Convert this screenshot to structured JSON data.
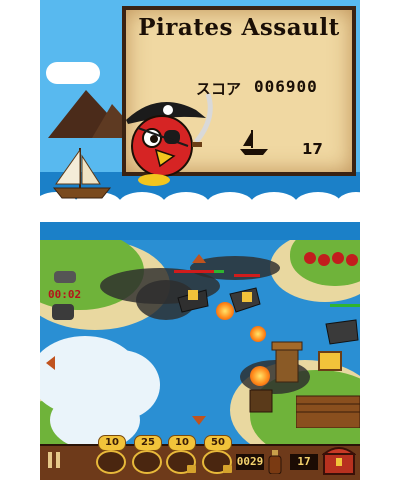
{
  "top_screen": {
    "title": "Pirates Assault",
    "score_label": "スコア",
    "score_value": "006900",
    "ships_remaining": "17"
  },
  "bottom_screen": {
    "timer": "00:02",
    "weapons": [
      {
        "cost": "10",
        "icon": "cannon-icon"
      },
      {
        "cost": "25",
        "icon": "skull-icon"
      },
      {
        "cost": "10",
        "icon": "barrel-icon",
        "locked": true
      },
      {
        "cost": "50",
        "icon": "bomb-icon",
        "locked": true
      }
    ],
    "gold": "0029",
    "lives": "17"
  },
  "colors": {
    "sky": "#58b9ef",
    "sea": "#2a8fd3",
    "parchment": "#f0d8a2",
    "hud_wood": "#6e3a1a",
    "coin_gold": "#f2c33a"
  }
}
